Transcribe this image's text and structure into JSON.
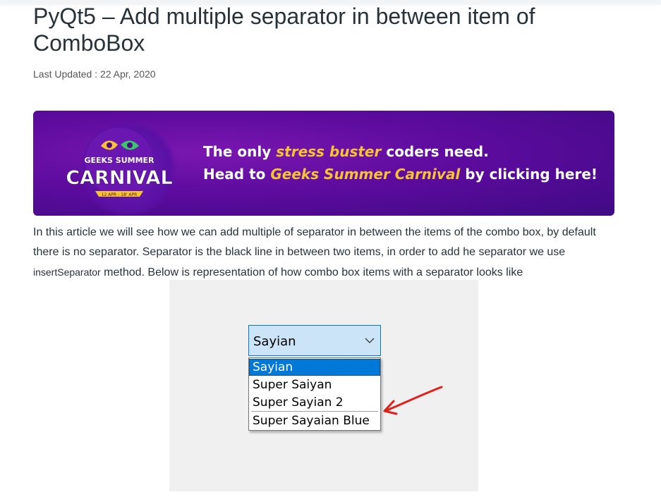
{
  "article": {
    "title": "PyQt5 – Add multiple separator in between item of ComboBox",
    "last_updated": "Last Updated : 22 Apr, 2020"
  },
  "banner": {
    "logo_top": "GEEKS SUMMER",
    "logo_main": "CARNIVAL",
    "logo_dates": "12 APR - 18' APR",
    "line1_pre": "The only ",
    "line1_highlight": "stress buster",
    "line1_post": " coders need.",
    "line2_pre": "Head to ",
    "line2_highlight": "Geeks Summer Carnival",
    "line2_post": " by clicking here!",
    "colors": {
      "bg": "#5d0b9e",
      "highlight": "#f7c233"
    }
  },
  "intro": {
    "part1": "In this article we will see how we can add multiple of separator in between the items of the combo box, by default there is no separator. Separator is the black line in between two items, in order to add he separator we use ",
    "code": "insertSeparator",
    "part2": " method. Below is representation of how combo box items with a separator looks like"
  },
  "combo": {
    "selected": "Sayian",
    "items": [
      "Sayian",
      "Super Saiyan",
      "Super Sayian 2",
      "Super Sayaian Blue"
    ],
    "icon": "chevron-down-icon",
    "colors": {
      "selection": "#0078d7",
      "combo_bg": "#cce4f7",
      "arrow": "#e0201b"
    }
  }
}
